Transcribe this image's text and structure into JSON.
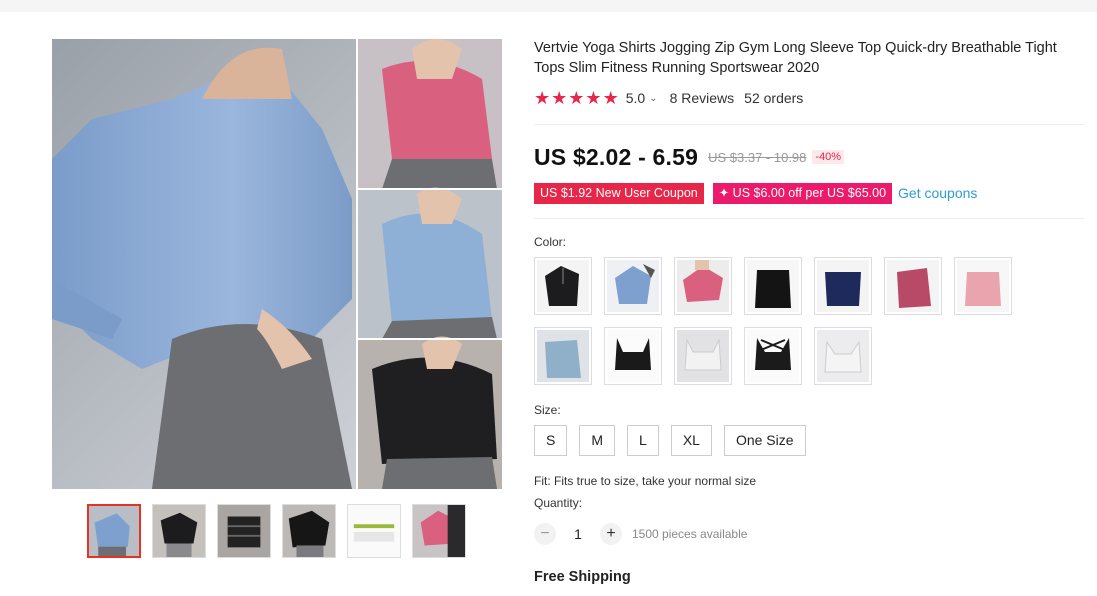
{
  "product": {
    "title": "Vertvie Yoga Shirts Jogging Zip Gym Long Sleeve Top Quick-dry Breathable Tight Tops Slim Fitness Running Sportswear 2020",
    "rating": "5.0",
    "rating_stars": 5,
    "reviews": "8 Reviews",
    "orders": "52 orders",
    "price": "US $2.02 - 6.59",
    "old_price": "US $3.37 - 10.98",
    "discount": "-40%",
    "coupon_new_user": "US $1.92 New User Coupon",
    "coupon_store": "✦ US $6.00 off per US $65.00",
    "get_coupons": "Get coupons",
    "color_label": "Color:",
    "size_label": "Size:",
    "sizes": [
      "S",
      "M",
      "L",
      "XL",
      "One Size"
    ],
    "fit": "Fit: Fits true to size, take your normal size",
    "quantity_label": "Quantity:",
    "quantity": "1",
    "available": "1500 pieces available",
    "shipping": "Free Shipping"
  },
  "colors": {
    "accent": "#e8264a",
    "link": "#2c9ecf",
    "swatches": [
      "#1c1c1e",
      "#7ea0cf",
      "#d9607e",
      "#141414",
      "#1e2a5c",
      "#b84a68",
      "#e9a4ad",
      "#8fb0c8",
      "#1a1a1a",
      "#f2f2f2",
      "#1b1b1b",
      "#f4f4f4"
    ]
  },
  "icons": {
    "star": "★",
    "chevron": "⌄",
    "minus": "−",
    "plus": "+"
  }
}
